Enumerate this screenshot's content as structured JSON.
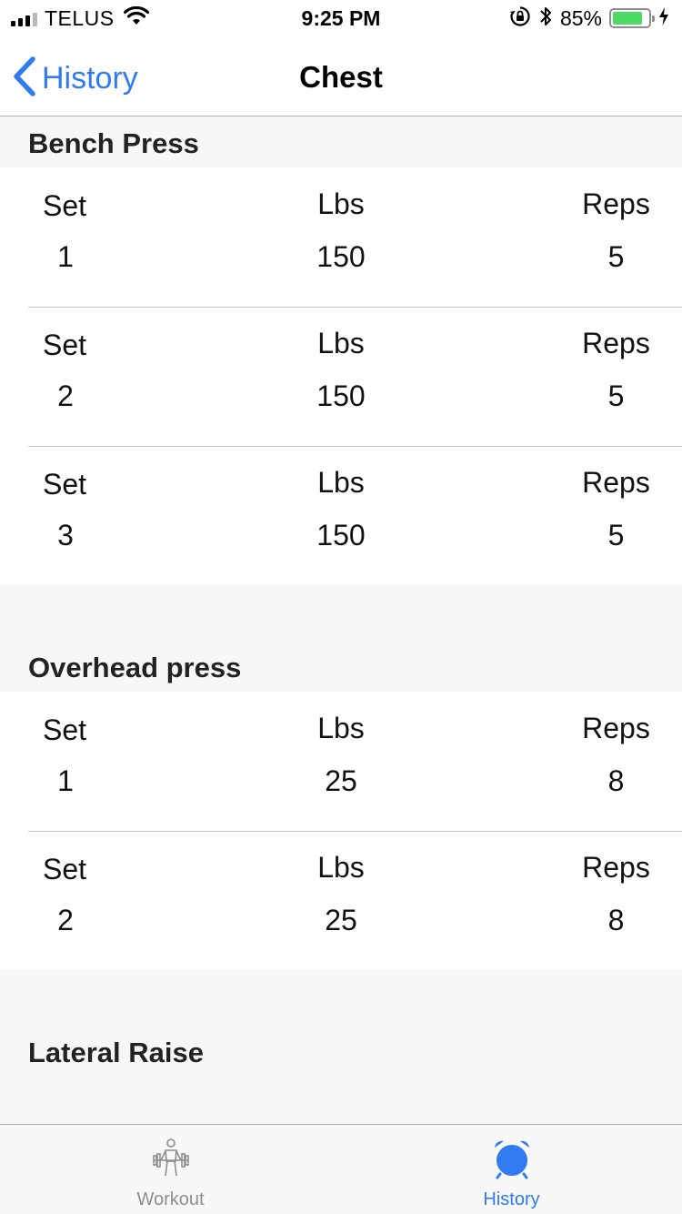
{
  "status_bar": {
    "carrier": "TELUS",
    "time": "9:25 PM",
    "battery_percent": "85%",
    "battery_level": 0.85,
    "battery_color": "#4cd964"
  },
  "nav": {
    "back_label": "History",
    "title": "Chest"
  },
  "column_labels": {
    "set": "Set",
    "lbs": "Lbs",
    "reps": "Reps"
  },
  "exercises": [
    {
      "name": "Bench Press",
      "sets": [
        {
          "set": "1",
          "lbs": "150",
          "reps": "5"
        },
        {
          "set": "2",
          "lbs": "150",
          "reps": "5"
        },
        {
          "set": "3",
          "lbs": "150",
          "reps": "5"
        }
      ]
    },
    {
      "name": "Overhead press",
      "sets": [
        {
          "set": "1",
          "lbs": "25",
          "reps": "8"
        },
        {
          "set": "2",
          "lbs": "25",
          "reps": "8"
        }
      ]
    },
    {
      "name": "Lateral Raise",
      "sets": []
    }
  ],
  "tab_bar": {
    "tabs": [
      {
        "label": "Workout",
        "icon": "weightlifter-icon",
        "active": false
      },
      {
        "label": "History",
        "icon": "alarm-clock-icon",
        "active": true
      }
    ],
    "accent_color": "#2f7bef",
    "inactive_color": "#8e8e8e"
  }
}
